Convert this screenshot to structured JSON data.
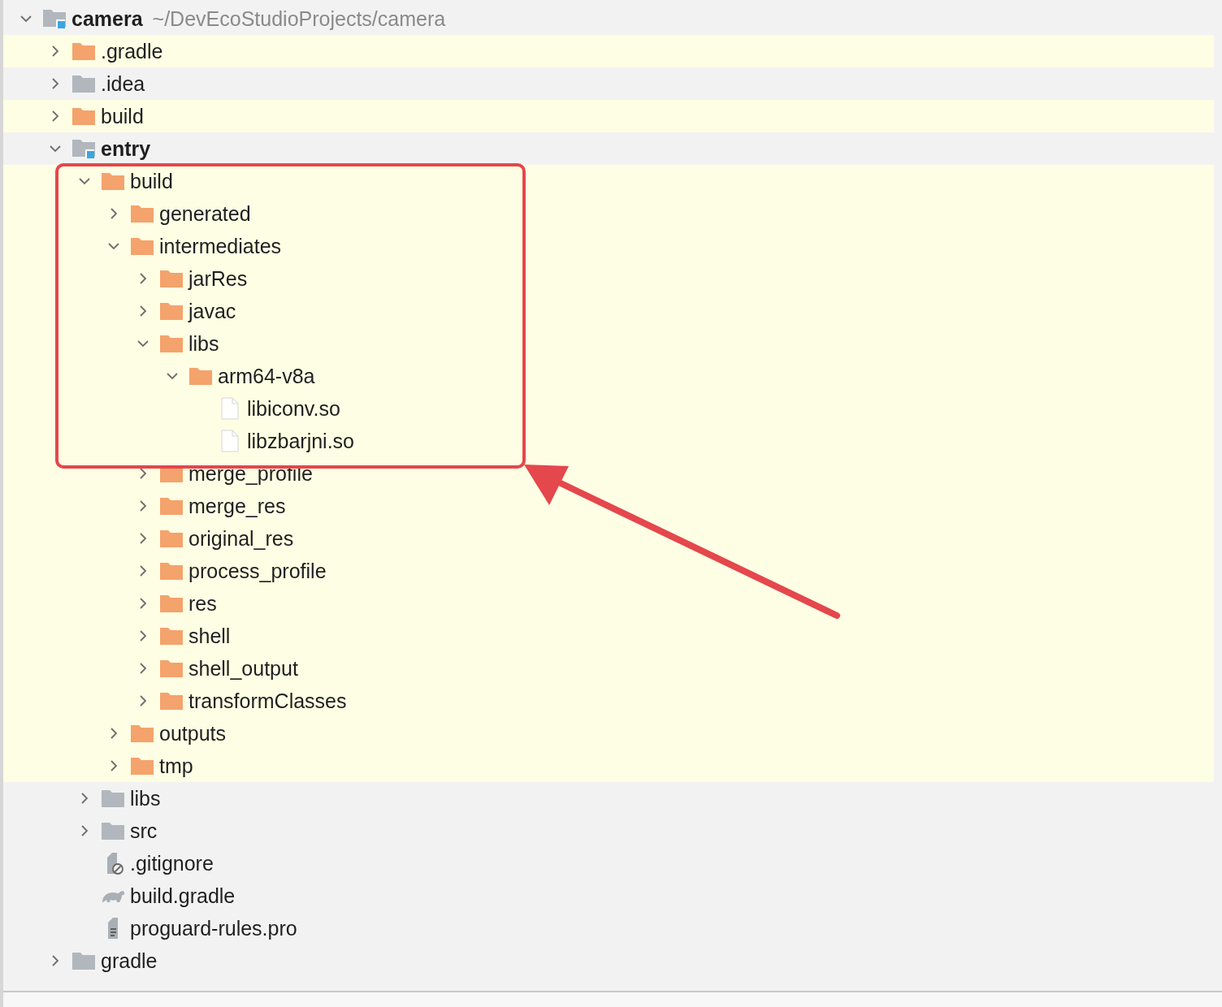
{
  "tree": {
    "name": "camera",
    "path": "~/DevEcoStudioProjects/camera",
    "kind": "module",
    "expanded": true,
    "children": [
      {
        "name": ".gradle",
        "kind": "excluded-folder",
        "expanded": false
      },
      {
        "name": ".idea",
        "kind": "folder",
        "expanded": false
      },
      {
        "name": "build",
        "kind": "excluded-folder",
        "expanded": false
      },
      {
        "name": "entry",
        "kind": "module",
        "expanded": true,
        "children": [
          {
            "name": "build",
            "kind": "excluded-folder",
            "expanded": true,
            "children": [
              {
                "name": "generated",
                "kind": "excluded-folder",
                "expanded": false
              },
              {
                "name": "intermediates",
                "kind": "excluded-folder",
                "expanded": true,
                "children": [
                  {
                    "name": "jarRes",
                    "kind": "excluded-folder",
                    "expanded": false
                  },
                  {
                    "name": "javac",
                    "kind": "excluded-folder",
                    "expanded": false
                  },
                  {
                    "name": "libs",
                    "kind": "excluded-folder",
                    "expanded": true,
                    "children": [
                      {
                        "name": "arm64-v8a",
                        "kind": "excluded-folder",
                        "expanded": true,
                        "children": [
                          {
                            "name": "libiconv.so",
                            "kind": "file"
                          },
                          {
                            "name": "libzbarjni.so",
                            "kind": "file"
                          }
                        ]
                      }
                    ]
                  },
                  {
                    "name": "merge_profile",
                    "kind": "excluded-folder",
                    "expanded": false
                  },
                  {
                    "name": "merge_res",
                    "kind": "excluded-folder",
                    "expanded": false
                  },
                  {
                    "name": "original_res",
                    "kind": "excluded-folder",
                    "expanded": false
                  },
                  {
                    "name": "process_profile",
                    "kind": "excluded-folder",
                    "expanded": false
                  },
                  {
                    "name": "res",
                    "kind": "excluded-folder",
                    "expanded": false
                  },
                  {
                    "name": "shell",
                    "kind": "excluded-folder",
                    "expanded": false
                  },
                  {
                    "name": "shell_output",
                    "kind": "excluded-folder",
                    "expanded": false
                  },
                  {
                    "name": "transformClasses",
                    "kind": "excluded-folder",
                    "expanded": false
                  }
                ]
              },
              {
                "name": "outputs",
                "kind": "excluded-folder",
                "expanded": false
              },
              {
                "name": "tmp",
                "kind": "excluded-folder",
                "expanded": false
              }
            ]
          },
          {
            "name": "libs",
            "kind": "folder",
            "expanded": false
          },
          {
            "name": "src",
            "kind": "folder",
            "expanded": false
          },
          {
            "name": ".gitignore",
            "kind": "ignore-file"
          },
          {
            "name": "build.gradle",
            "kind": "gradle-file"
          },
          {
            "name": "proguard-rules.pro",
            "kind": "text-file"
          }
        ]
      },
      {
        "name": "gradle",
        "kind": "folder",
        "expanded": false
      }
    ]
  }
}
